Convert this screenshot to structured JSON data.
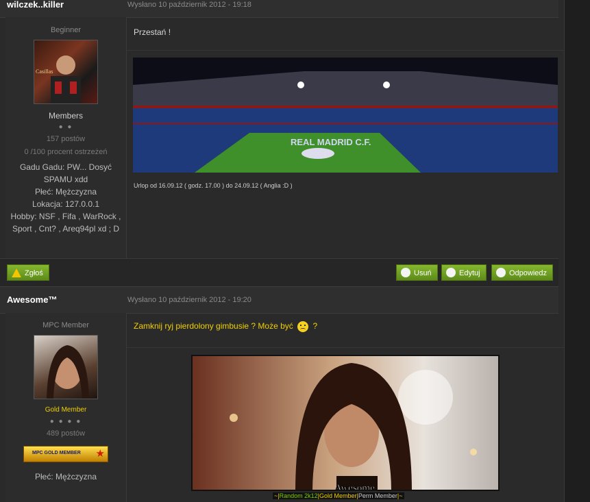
{
  "posts": [
    {
      "author": "wilczek..killer",
      "date": "Wysłano 10 październik 2012 - 19:18",
      "rank": "Beginner",
      "group": "Members",
      "dots": "● ●",
      "posts_count": "157 postów",
      "warnings": "0 /100 procent ostrzeżeń",
      "profile": [
        "Gadu Gadu: PW... Dosyć SPAMU xdd",
        "Płeć: Mężczyzna",
        "Lokacja: 127.0.0.1",
        "Hobby: NSF , Fifa , WarRock , Sport , Cnt? , Areq94pl xd ; D"
      ],
      "text": "Przestań !",
      "signature_text": "Urlop od 16.09.12 ( godz. 17.00 ) do 24.09.12 ( Anglia :D )",
      "banner_text": "REAL MADRID C.F.",
      "avatar_text": "Casillas"
    },
    {
      "author": "Awesome™",
      "date": "Wysłano 10 październik 2012 - 19:20",
      "rank": "MPC Member",
      "group": "Gold Member",
      "dots": "● ● ● ●",
      "posts_count": "489 postów",
      "badge": "MPC GOLD MEMBER",
      "profile": [
        "Płeć: Mężczyzna"
      ],
      "text_before": "Zamknij ryj pierdolony gimbusie ? Może być",
      "text_after": "?",
      "banner_title": "Awesome",
      "banner_tags": [
        "~",
        "|",
        "Random 2k12",
        "|",
        "Gold Member",
        "|",
        "Perm Member",
        "|",
        "~"
      ]
    }
  ],
  "buttons": {
    "report": "Zgłoś",
    "delete": "Usuń",
    "edit": "Edytuj",
    "reply": "Odpowiedz"
  },
  "colors": {
    "button_green": "#6e9e22",
    "gold_text": "#f0d000",
    "tag_green": "#7cd000",
    "tag_yellow": "#f0d000"
  }
}
